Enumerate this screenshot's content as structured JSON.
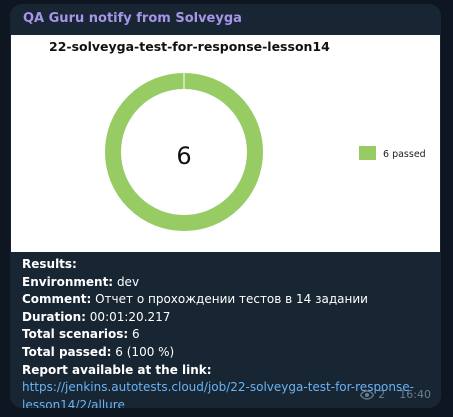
{
  "message": {
    "sender": "QA Guru notify from Solveyga",
    "views": "2",
    "time": "16:40"
  },
  "chart_data": {
    "type": "pie",
    "title": "22-solveyga-test-for-response-lesson14",
    "center_label": "6",
    "slices": [
      {
        "label": "6 passed",
        "value": 6,
        "color": "#97cc64"
      }
    ],
    "legend_position": "right"
  },
  "results": {
    "heading": "Results:",
    "environment_label": "Environment:",
    "environment_value": "dev",
    "comment_label": "Comment:",
    "comment_value": "Отчет о прохождении тестов в 14 задании",
    "duration_label": "Duration:",
    "duration_value": "00:01:20.217",
    "scenarios_label": "Total scenarios:",
    "scenarios_value": "6",
    "passed_label": "Total passed:",
    "passed_value": "6 (100 %)",
    "report_label": "Report available at the link:",
    "report_link": "https://jenkins.autotests.cloud/job/22-solveyga-test-for-response-lesson14/2/allure"
  }
}
